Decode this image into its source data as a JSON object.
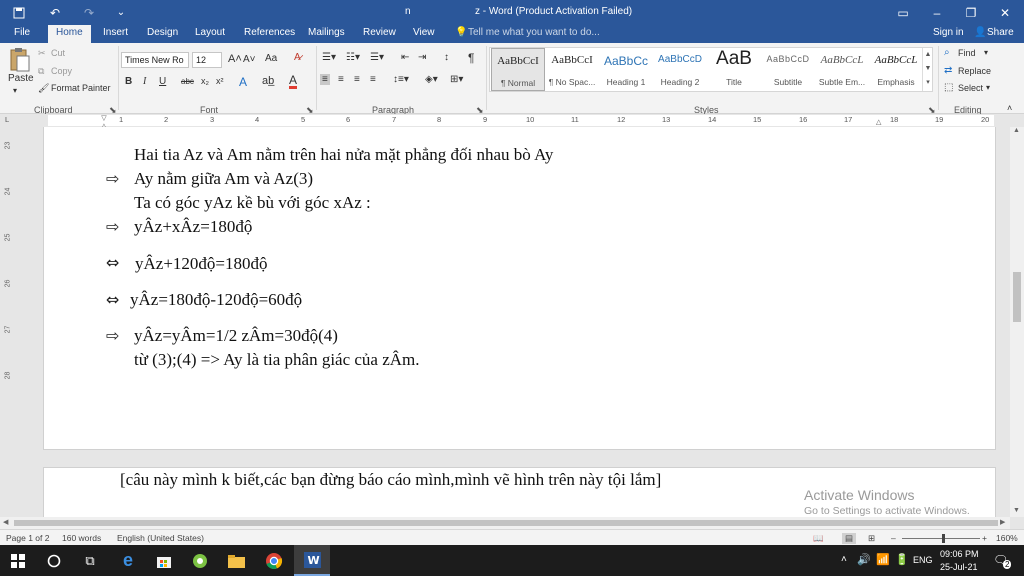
{
  "titlebar": {
    "doc": "n",
    "title": "z - Word (Product Activation Failed)"
  },
  "tabs": [
    "File",
    "Home",
    "Insert",
    "Design",
    "Layout",
    "References",
    "Mailings",
    "Review",
    "View"
  ],
  "tell_me": "Tell me what you want to do...",
  "signin": "Sign in",
  "share": "Share",
  "clipboard": {
    "paste": "Paste",
    "cut": "Cut",
    "copy": "Copy",
    "format_painter": "Format Painter",
    "label": "Clipboard"
  },
  "font": {
    "name": "Times New Ro",
    "size": "12",
    "label": "Font",
    "aa": "Aa",
    "bold": "B",
    "italic": "I",
    "underline": "U",
    "strike": "abc",
    "sub": "x₂",
    "sup": "x²"
  },
  "paragraph": {
    "label": "Paragraph"
  },
  "styles": {
    "label": "Styles",
    "items": [
      {
        "preview": "AaBbCcI",
        "name": "¶ Normal"
      },
      {
        "preview": "AaBbCcI",
        "name": "¶ No Spac..."
      },
      {
        "preview": "AaBbCc",
        "name": "Heading 1"
      },
      {
        "preview": "AaBbCcD",
        "name": "Heading 2"
      },
      {
        "preview": "AaB",
        "name": "Title"
      },
      {
        "preview": "AaBbCcD",
        "name": "Subtitle"
      },
      {
        "preview": "AaBbCcL",
        "name": "Subtle Em..."
      },
      {
        "preview": "AaBbCcL",
        "name": "Emphasis"
      }
    ]
  },
  "editing": {
    "label": "Editing",
    "find": "Find",
    "replace": "Replace",
    "select": "Select"
  },
  "ruler": {
    "ticks": [
      "1",
      "2",
      "3",
      "4",
      "5",
      "6",
      "7",
      "8",
      "9",
      "10",
      "11",
      "12",
      "13",
      "14",
      "15",
      "16",
      "17",
      "18",
      "19",
      "20"
    ]
  },
  "vruler": {
    "ticks": [
      "23",
      "24",
      "25",
      "26",
      "27",
      "28"
    ]
  },
  "document": {
    "lines": [
      "Hai tia Az và Am nằm trên hai nửa mặt phẳng đối nhau bò Ay",
      "Ay nằm giữa Am và Az(3)",
      "Ta có góc yAz kề bù với góc xAz :",
      "yÂz+xÂz=180độ",
      "yÂz+120độ=180độ",
      "yÂz=180độ-120độ=60độ",
      "yÂz=yÂm=1/2 zÂm=30độ(4)",
      "từ (3);(4) => Ay là tia phân giác của zÂm."
    ],
    "page2": "[câu này mình k biết,các bạn đừng báo cáo mình,mình vẽ hình trên này tội lắm]"
  },
  "watermark": {
    "title": "Activate Windows",
    "sub": "Go to Settings to activate Windows."
  },
  "status": {
    "page": "Page 1 of 2",
    "words": "160 words",
    "lang": "English (United States)",
    "zoom": "160%"
  },
  "taskbar": {
    "lang": "ENG",
    "time": "09:06 PM",
    "date": "25-Jul-21",
    "notifications": "2"
  }
}
